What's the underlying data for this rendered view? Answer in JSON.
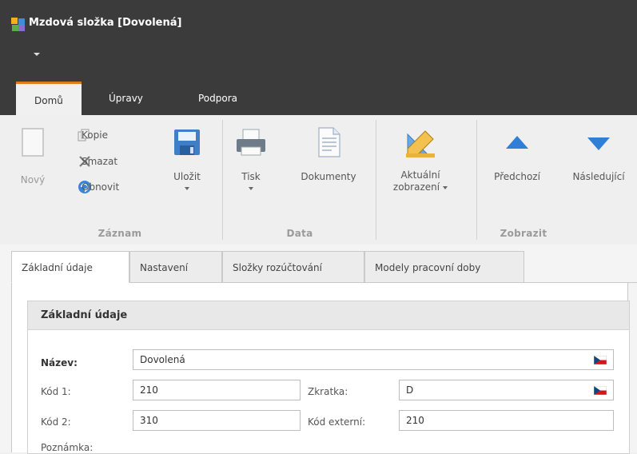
{
  "window": {
    "title": "Mzdová složka [Dovolená]"
  },
  "ribbon_tabs": [
    {
      "label": "Domů",
      "active": true
    },
    {
      "label": "Úpravy",
      "active": false
    },
    {
      "label": "Podpora",
      "active": false
    }
  ],
  "ribbon": {
    "groups": {
      "zaznam": "Záznam",
      "data": "Data",
      "zobrazit": "Zobrazit"
    },
    "buttons": {
      "novy": "Nový",
      "kopie": "Kopie",
      "smazat": "Smazat",
      "obnovit": "Obnovit",
      "ulozit": "Uložit",
      "tisk": "Tisk",
      "dokumenty": "Dokumenty",
      "aktualni_line1": "Aktuální",
      "aktualni_line2": "zobrazení",
      "predchozi": "Předchozí",
      "nasledujici": "Následující"
    }
  },
  "doc_tabs": [
    {
      "label": "Základní údaje",
      "active": true
    },
    {
      "label": "Nastavení",
      "active": false
    },
    {
      "label": "Složky rozúčtování",
      "active": false
    },
    {
      "label": "Modely pracovní doby",
      "active": false
    }
  ],
  "form": {
    "section_title": "Základní údaje",
    "nazev_label": "Název:",
    "nazev_value": "Dovolená",
    "kod1_label": "Kód 1:",
    "kod1_value": "210",
    "zkratka_label": "Zkratka:",
    "zkratka_value": "D",
    "kod2_label": "Kód 2:",
    "kod2_value": "310",
    "kod_externi_label": "Kód externí:",
    "kod_externi_value": "210",
    "poznamka_label": "Poznámka:"
  },
  "colors": {
    "titlebar": "#3b3b3b",
    "accent_tab": "#e07a1a",
    "arrow_blue": "#2f7fd6"
  }
}
